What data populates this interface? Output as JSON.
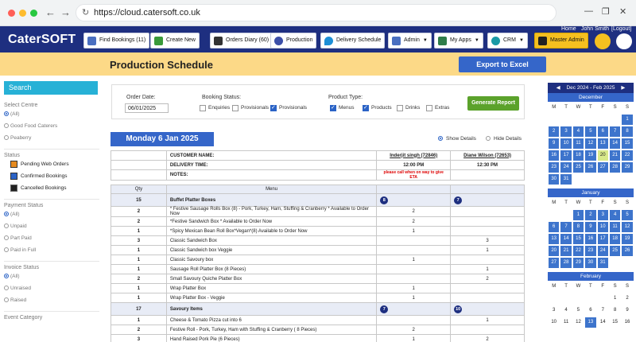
{
  "browser": {
    "url": "https://cloud.catersoft.co.uk"
  },
  "nav": {
    "logo_a": "Cater",
    "logo_b": "SOFT",
    "find_bookings": "Find Bookings (11)",
    "create_new": "Create New",
    "orders_diary": "Orders Diary (60)",
    "production": "Production",
    "delivery_schedule": "Delivery Schedule",
    "admin": "Admin",
    "my_apps": "My Apps",
    "crm": "CRM",
    "master_admin": "Master Admin",
    "home": "Home",
    "user": "John Smith",
    "logout": "[Logout]"
  },
  "page": {
    "title": "Production Schedule",
    "export": "Export to Excel"
  },
  "sidebar": {
    "search": "Search",
    "select_centre": "Select Centre",
    "centres": [
      "(All)",
      "Good Food Caterers",
      "Peaberry"
    ],
    "status_head": "Status",
    "statuses": [
      "Pending Web Orders",
      "Confirmed Bookings",
      "Cancelled Bookings"
    ],
    "payment_head": "Payment Status",
    "payments": [
      "(All)",
      "Unpaid",
      "Part Paid",
      "Paid in Full"
    ],
    "invoice_head": "Invoice Status",
    "invoices": [
      "(All)",
      "Unraised",
      "Raised"
    ],
    "event_head": "Event Category"
  },
  "filters": {
    "order_date_label": "Order Date:",
    "order_date": "06/01/2025",
    "booking_status_label": "Booking Status:",
    "enquiries": "Enquiries",
    "provisionals_1": "Provisionals",
    "provisionals_2": "Provisionals",
    "product_type_label": "Product Type:",
    "menus": "Menus",
    "products": "Products",
    "drinks": "Drinks",
    "extras": "Extras",
    "generate": "Generate Report"
  },
  "day": {
    "title": "Monday 6 Jan 2025",
    "show": "Show Details",
    "hide": "Hide Details"
  },
  "info": {
    "customer_label": "CUSTOMER NAME:",
    "delivery_label": "DELIVERY TIME:",
    "notes_label": "NOTES:",
    "cust1": "Inderjit singh (72846)",
    "cust2": "Diane Wilson (72653)",
    "time1": "12:00 PM",
    "time2": "12:30 PM",
    "note1": "please call when on way to give ETA"
  },
  "table": {
    "qty_header": "Qty",
    "menu_header": "Menu",
    "group1": {
      "qty": "15",
      "name": "Buffet Platter Boxes",
      "b1": "8",
      "b2": "7"
    },
    "rows1": [
      {
        "qty": "2",
        "item": "* Festive Sausage Rolls Box (8) - Pork, Turkey, Ham, Stuffing & Cranberry * Available to Order Now",
        "c1": "2",
        "c2": ""
      },
      {
        "qty": "2",
        "item": "*Festive Sandwich Box * Available to Order Now",
        "c1": "2",
        "c2": ""
      },
      {
        "qty": "1",
        "item": "*Spicy Mexican Bean Roll Box*Vegan*(8) Available to Order Now",
        "c1": "1",
        "c2": ""
      },
      {
        "qty": "3",
        "item": "Classic Sandwich Box",
        "c1": "",
        "c2": "3"
      },
      {
        "qty": "1",
        "item": "Classic Sandwich box Veggie",
        "c1": "",
        "c2": "1"
      },
      {
        "qty": "1",
        "item": "Classic Savoury box",
        "c1": "1",
        "c2": ""
      },
      {
        "qty": "1",
        "item": "Sausage Roll Platter Box (8 Pieces)",
        "c1": "",
        "c2": "1"
      },
      {
        "qty": "2",
        "item": "Small Savoury Quiche Platter Box",
        "c1": "",
        "c2": "2"
      },
      {
        "qty": "1",
        "item": "Wrap Platter Box",
        "c1": "1",
        "c2": ""
      },
      {
        "qty": "1",
        "item": "Wrap Platter Box - Veggie",
        "c1": "1",
        "c2": ""
      }
    ],
    "group2": {
      "qty": "17",
      "name": "Savoury Items",
      "b1": "7",
      "b2": "10"
    },
    "rows2": [
      {
        "qty": "1",
        "item": "Cheese & Tomato Pizza cut into 6",
        "c1": "",
        "c2": "1"
      },
      {
        "qty": "2",
        "item": "Festive Roll - Pork, Turkey, Ham with Stuffing & Cranberry ( 8 Pieces)",
        "c1": "2",
        "c2": ""
      },
      {
        "qty": "3",
        "item": "Hand Raised Pork Pie (6 Pieces)",
        "c1": "1",
        "c2": "2"
      }
    ]
  },
  "calendar": {
    "range": "Dec 2024 - Feb 2025",
    "dow": [
      "M",
      "T",
      "W",
      "T",
      "F",
      "S",
      "S"
    ],
    "months": [
      {
        "name": "December",
        "weeks": [
          [
            "",
            "",
            "",
            "",
            "",
            "",
            "1"
          ],
          [
            "2",
            "3",
            "4",
            "5",
            "6",
            "7",
            "8"
          ],
          [
            "9",
            "10",
            "11",
            "12",
            "13",
            "14",
            "15"
          ],
          [
            "16",
            "17",
            "18",
            "19",
            "20",
            "21",
            "22"
          ],
          [
            "23",
            "24",
            "25",
            "26",
            "27",
            "28",
            "29"
          ],
          [
            "30",
            "31",
            "",
            "",
            "",
            "",
            ""
          ]
        ]
      },
      {
        "name": "January",
        "weeks": [
          [
            "",
            "",
            "1",
            "2",
            "3",
            "4",
            "5"
          ],
          [
            "6",
            "7",
            "8",
            "9",
            "10",
            "11",
            "12"
          ],
          [
            "13",
            "14",
            "15",
            "16",
            "17",
            "18",
            "19"
          ],
          [
            "20",
            "21",
            "22",
            "23",
            "24",
            "25",
            "26"
          ],
          [
            "27",
            "28",
            "29",
            "30",
            "31",
            "",
            ""
          ]
        ]
      },
      {
        "name": "February",
        "weeks": [
          [
            "",
            "",
            "",
            "",
            "",
            "1",
            "2"
          ],
          [
            "3",
            "4",
            "5",
            "6",
            "7",
            "8",
            "9"
          ],
          [
            "10",
            "11",
            "12",
            "13",
            "14",
            "15",
            "16"
          ]
        ]
      }
    ]
  }
}
